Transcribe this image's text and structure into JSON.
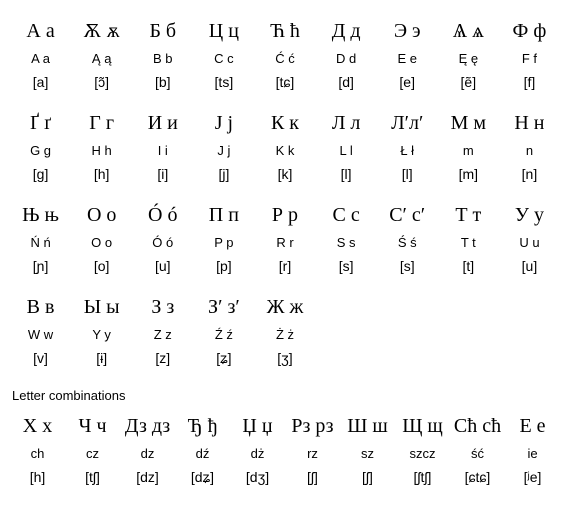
{
  "blocks": [
    {
      "cols": 9,
      "rows": [
        {
          "class": "cyr",
          "cells": [
            "А а",
            "Ѫ ѫ",
            "Б б",
            "Ц ц",
            "Ћ ћ",
            "Д д",
            "Э э",
            "Ѧ ѧ",
            "Ф ф"
          ]
        },
        {
          "class": "lat",
          "cells": [
            "A a",
            "Ą ą",
            "B b",
            "C c",
            "Ć ć",
            "D d",
            "E e",
            "Ę ę",
            "F f"
          ]
        },
        {
          "class": "ipa",
          "cells": [
            "[a]",
            "[ɔ̃]",
            "[b]",
            "[ts]",
            "[tɕ]",
            "[d]",
            "[e]",
            "[ẽ]",
            "[f]"
          ]
        }
      ]
    },
    {
      "cols": 9,
      "rows": [
        {
          "class": "cyr",
          "cells": [
            "Ґ ґ",
            "Г г",
            "И и",
            "Ј ј",
            "К к",
            "Л л",
            "Л′л′",
            "М м",
            "Н н"
          ]
        },
        {
          "class": "lat",
          "cells": [
            "G g",
            "H h",
            "I i",
            "J j",
            "K k",
            "L l",
            "Ł ł",
            "m",
            "n"
          ]
        },
        {
          "class": "ipa",
          "cells": [
            "[g]",
            "[h]",
            "[i]",
            "[j]",
            "[k]",
            "[l]",
            "[l]",
            "[m]",
            "[n]"
          ]
        }
      ]
    },
    {
      "cols": 9,
      "rows": [
        {
          "class": "cyr",
          "cells": [
            "Њ њ",
            "О о",
            "Ó ó",
            "П п",
            "Р р",
            "С с",
            "С′ с′",
            "Т т",
            "У у"
          ]
        },
        {
          "class": "lat",
          "cells": [
            "Ń ń",
            "O o",
            "Ó ó",
            "P p",
            "R r",
            "S s",
            "Ś ś",
            "T t",
            "U u"
          ]
        },
        {
          "class": "ipa",
          "cells": [
            "[ɲ]",
            "[o]",
            "[u]",
            "[p]",
            "[r]",
            "[s]",
            "[s]",
            "[t]",
            "[u]"
          ]
        }
      ]
    },
    {
      "cols": 9,
      "rows": [
        {
          "class": "cyr",
          "cells": [
            "В в",
            "Ы ы",
            "З з",
            "З′ з′",
            "Ж ж",
            "",
            "",
            "",
            ""
          ]
        },
        {
          "class": "lat",
          "cells": [
            "W w",
            "Y y",
            "Z z",
            "Ź ź",
            "Ż ż",
            "",
            "",
            "",
            ""
          ]
        },
        {
          "class": "ipa",
          "cells": [
            "[v]",
            "[ɨ]",
            "[z]",
            "[ʑ]",
            "[ʒ]",
            "",
            "",
            "",
            ""
          ]
        }
      ]
    }
  ],
  "combinations_label": "Letter combinations",
  "combinations": {
    "cols": 10,
    "rows": [
      {
        "class": "cyr",
        "cells": [
          "Х х",
          "Ч ч",
          "Дз дз",
          "Ђ ђ",
          "Џ џ",
          "Рз рз",
          "Ш ш",
          "Щ щ",
          "Сћ сћ",
          "Е е"
        ]
      },
      {
        "class": "lat",
        "cells": [
          "ch",
          "cz",
          "dz",
          "dź",
          "dż",
          "rz",
          "sz",
          "szcz",
          "ść",
          "ie"
        ]
      },
      {
        "class": "ipa",
        "cells": [
          "[h]",
          "[tʃ]",
          "[dz]",
          "[dʑ]",
          "[dʒ]",
          "[ʃ]",
          "[ʃ]",
          "[ʃtʃ]",
          "[ɕtɕ]",
          "[ʲe]"
        ]
      }
    ]
  }
}
